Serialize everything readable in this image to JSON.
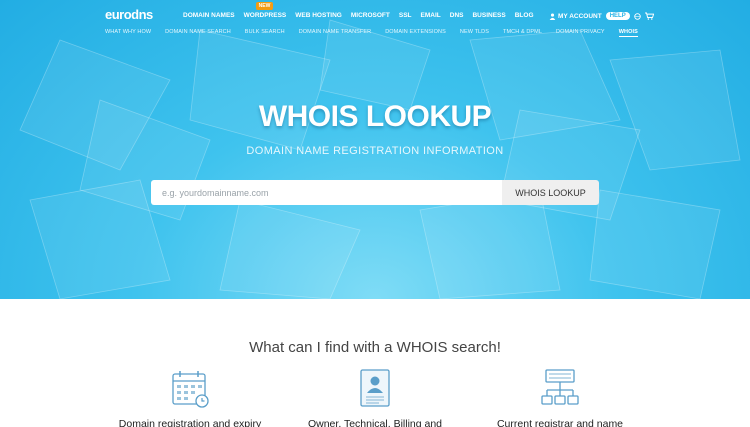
{
  "logo": "eurodns",
  "main_nav": {
    "items": [
      "DOMAIN NAMES",
      "WORDPRESS",
      "WEB HOSTING",
      "MICROSOFT",
      "SSL",
      "EMAIL",
      "DNS",
      "BUSINESS",
      "BLOG"
    ],
    "new_badge": "NEW"
  },
  "account": {
    "label": "MY ACCOUNT",
    "help": "HELP"
  },
  "sub_nav": {
    "items": [
      "WHAT WHY HOW",
      "DOMAIN NAME SEARCH",
      "BULK SEARCH",
      "DOMAIN NAME TRANSFER",
      "DOMAIN EXTENSIONS",
      "NEW TLDS",
      "TMCH & DPML",
      "DOMAIN PRIVACY",
      "WHOIS"
    ],
    "active": "WHOIS"
  },
  "hero": {
    "title": "WHOIS LOOKUP",
    "subtitle": "DOMAIN NAME REGISTRATION INFORMATION",
    "search_placeholder": "e.g. yourdomainname.com",
    "search_value": "",
    "button_label": "WHOIS LOOKUP"
  },
  "features": {
    "title": "What can I find with a WHOIS search!",
    "items": [
      {
        "label": "Domain registration and expiry",
        "icon": "calendar-icon"
      },
      {
        "label": "Owner, Technical, Billing and",
        "icon": "contact-card-icon"
      },
      {
        "label": "Current registrar and name",
        "icon": "sitemap-icon"
      }
    ]
  },
  "colors": {
    "hero": "#29b3e6",
    "badge": "#f39c12",
    "button_bg": "#efefef"
  }
}
